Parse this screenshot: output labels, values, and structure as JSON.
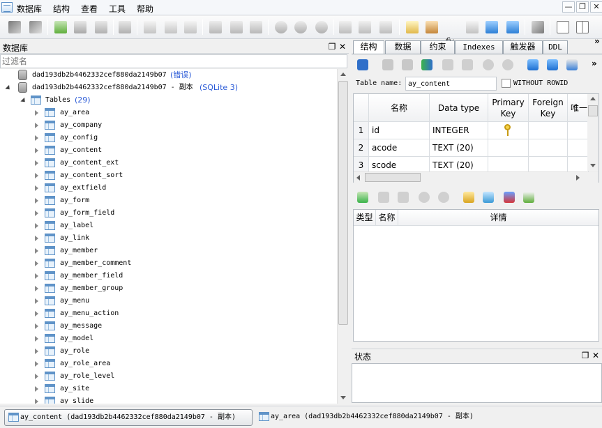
{
  "menu": [
    "数据库",
    "结构",
    "查看",
    "工具",
    "帮助"
  ],
  "left_panel": {
    "title": "数据库",
    "filter_placeholder": "过滤名",
    "databases": [
      {
        "name": "dad193db2b4462332cef880da2149b07",
        "tag": "(错误)"
      },
      {
        "name": "dad193db2b4462332cef880da2149b07 - 副本",
        "tag": "(SQLite 3)"
      }
    ],
    "tables_node": {
      "label": "Tables",
      "count": "(29)"
    },
    "tables": [
      "ay_area",
      "ay_company",
      "ay_config",
      "ay_content",
      "ay_content_ext",
      "ay_content_sort",
      "ay_extfield",
      "ay_form",
      "ay_form_field",
      "ay_label",
      "ay_link",
      "ay_member",
      "ay_member_comment",
      "ay_member_field",
      "ay_member_group",
      "ay_menu",
      "ay_menu_action",
      "ay_message",
      "ay_model",
      "ay_role",
      "ay_role_area",
      "ay_role_level",
      "ay_site",
      "ay_slide"
    ]
  },
  "tabs": [
    "结构",
    "数据",
    "约束",
    "Indexes",
    "触发器",
    "DDL"
  ],
  "structure": {
    "table_name_label": "Table name:",
    "table_name_value": "ay_content",
    "without_rowid_label": "WITHOUT ROWID",
    "columns": [
      "名称",
      "Data type",
      "Primary Key",
      "Foreign Key",
      "唯一"
    ],
    "rows": [
      {
        "n": "1",
        "name": "id",
        "type": "INTEGER",
        "pk": true
      },
      {
        "n": "2",
        "name": "acode",
        "type": "TEXT (20)",
        "pk": false
      },
      {
        "n": "3",
        "name": "scode",
        "type": "TEXT (20)",
        "pk": false
      }
    ]
  },
  "index_table": {
    "columns": [
      "类型",
      "名称",
      "详情"
    ]
  },
  "status_panel": {
    "title": "状态"
  },
  "bottom_tabs": [
    {
      "label": "ay_content (dad193db2b4462332cef880da2149b07 - 副本)",
      "active": true
    },
    {
      "label": "ay_area (dad193db2b4462332cef880da2149b07 - 副本)",
      "active": false
    }
  ],
  "window_buttons": [
    "—",
    "❐",
    "✕"
  ],
  "colors": {
    "tag_blue": "#2a5ad7",
    "accent": "#5f93c8"
  }
}
